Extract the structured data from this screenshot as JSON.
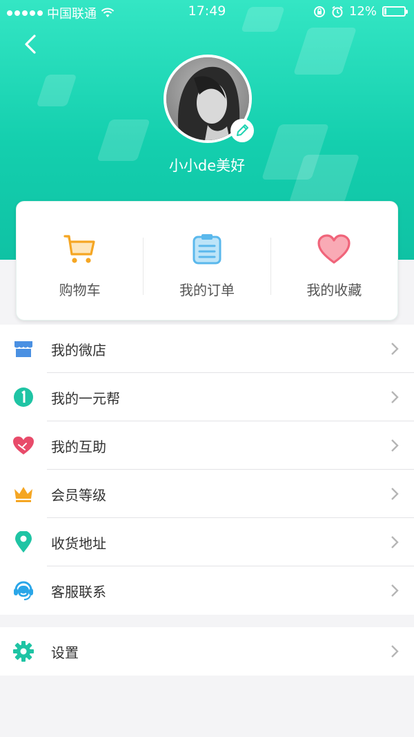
{
  "status_bar": {
    "carrier": "中国联通",
    "time": "17:49",
    "battery": "12%",
    "battery_level": 0.12
  },
  "profile": {
    "username": "小小de美好"
  },
  "quick_actions": [
    {
      "label": "购物车",
      "icon": "shopping-cart-icon"
    },
    {
      "label": "我的订单",
      "icon": "order-clipboard-icon"
    },
    {
      "label": "我的收藏",
      "icon": "heart-icon"
    }
  ],
  "menu": [
    {
      "label": "我的微店",
      "icon": "store-icon"
    },
    {
      "label": "我的一元帮",
      "icon": "number-one-badge-icon"
    },
    {
      "label": "我的互助",
      "icon": "heart-handshake-icon"
    },
    {
      "label": "会员等级",
      "icon": "crown-icon"
    },
    {
      "label": "收货地址",
      "icon": "location-pin-icon"
    },
    {
      "label": "客服联系",
      "icon": "customer-service-icon"
    }
  ],
  "settings": {
    "label": "设置",
    "icon": "gear-icon"
  },
  "colors": {
    "accent": "#1fd3b2",
    "cart": "#f5a623",
    "order": "#5ab8ec",
    "heart": "#f0647a",
    "store": "#4a90e2",
    "crown": "#f5a623"
  }
}
